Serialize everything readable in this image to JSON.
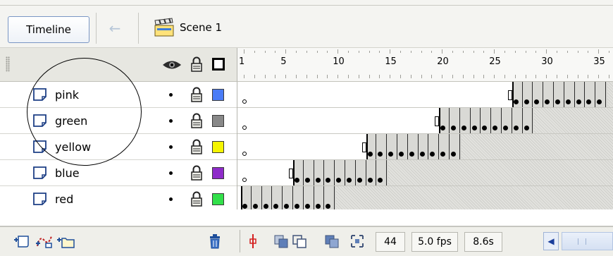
{
  "toolbar": {
    "timeline_button_label": "Timeline",
    "back_icon": "back-arrow-icon",
    "scene_icon": "clapperboard-icon",
    "scene_label": "Scene 1"
  },
  "layer_header": {
    "eye_icon": "eye-icon",
    "lock_icon": "lock-icon",
    "outline_icon": "outline-square-icon"
  },
  "ruler": {
    "labels": [
      "1",
      "5",
      "10",
      "15",
      "20",
      "25",
      "30",
      "35"
    ]
  },
  "layers": [
    {
      "name": "pink",
      "color": "#4a7cf7",
      "tween_start_frame": 27,
      "keyframes_from": 27
    },
    {
      "name": "green",
      "color": "#888888",
      "tween_start_frame": 20,
      "keyframes_from": 20
    },
    {
      "name": "yellow",
      "color": "#f5f500",
      "tween_start_frame": 13,
      "keyframes_from": 13
    },
    {
      "name": "blue",
      "color": "#8e2bc9",
      "tween_start_frame": 6,
      "keyframes_from": 6
    },
    {
      "name": "red",
      "color": "#32e04a",
      "tween_start_frame": 1,
      "keyframes_from": 1
    }
  ],
  "bottom_bar": {
    "add_layer_icon": "insert-layer-icon",
    "add_guide_icon": "add-motion-guide-icon",
    "add_folder_icon": "insert-folder-icon",
    "delete_icon": "trash-icon",
    "current_frame": "44",
    "frame_rate": "5.0 fps",
    "elapsed_time": "8.6s"
  },
  "colors": {
    "selection_blue": "#7a96c4",
    "panel_bg": "#f4f4f1"
  }
}
